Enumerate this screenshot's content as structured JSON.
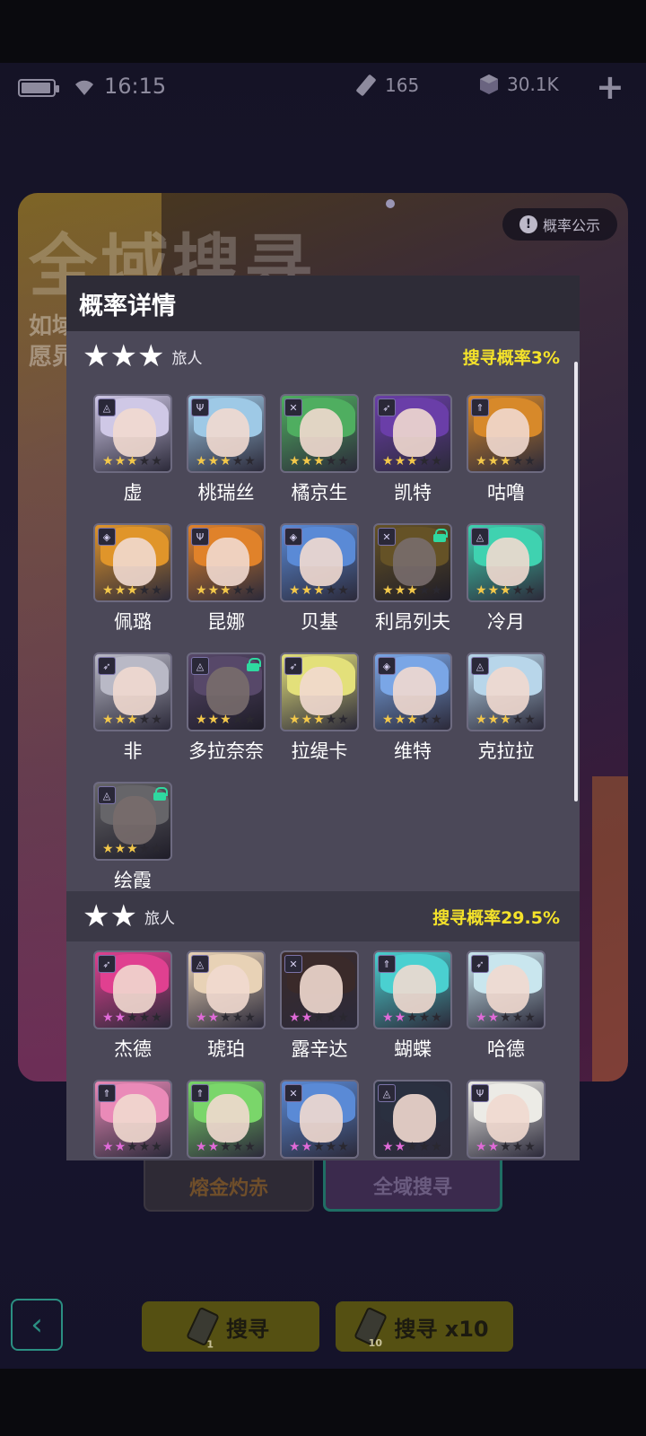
{
  "status_bar": {
    "time": "16:15",
    "ticket_count": "165",
    "crystal_count": "30.1K",
    "add_label": "+"
  },
  "banner": {
    "title": "全域搜寻",
    "line1": "如域",
    "line2": "愿晁",
    "prob_button": "概率公示"
  },
  "tabs": {
    "left": "熔金灼赤",
    "right": "全域搜寻"
  },
  "actions": {
    "search_one": "搜寻",
    "search_ten": "搜寻 x10",
    "ticket_one": "1",
    "ticket_ten": "10"
  },
  "modal": {
    "title": "概率详情",
    "tiers": [
      {
        "stars": "★★★",
        "label": "旅人",
        "rate": "搜寻概率3%",
        "characters": [
          {
            "name": "虚",
            "class_icon": "cursed-icon",
            "locked": false,
            "hair": "#cfc8e6"
          },
          {
            "name": "桃瑞丝",
            "class_icon": "trident-icon",
            "locked": false,
            "hair": "#9ec9e6"
          },
          {
            "name": "橘京生",
            "class_icon": "swords-icon",
            "locked": false,
            "hair": "#4fae60"
          },
          {
            "name": "凯特",
            "class_icon": "bow-icon",
            "locked": false,
            "hair": "#6a3ea8"
          },
          {
            "name": "咕噜",
            "class_icon": "rank-icon",
            "locked": false,
            "hair": "#d7892a"
          },
          {
            "name": "佩璐",
            "class_icon": "diamond-icon",
            "locked": false,
            "hair": "#e0952a"
          },
          {
            "name": "昆娜",
            "class_icon": "trident-icon",
            "locked": false,
            "hair": "#e0822a"
          },
          {
            "name": "贝基",
            "class_icon": "diamond-icon",
            "locked": false,
            "hair": "#5a8ad6"
          },
          {
            "name": "利昂列夫",
            "class_icon": "swords-icon",
            "locked": true,
            "hair": "#c7a035"
          },
          {
            "name": "冷月",
            "class_icon": "cursed-icon",
            "locked": false,
            "hair": "#3fd2b0"
          },
          {
            "name": "非",
            "class_icon": "bow-icon",
            "locked": false,
            "hair": "#b9b9c6"
          },
          {
            "name": "多拉奈奈",
            "class_icon": "cursed-icon",
            "locked": true,
            "hair": "#a98acb"
          },
          {
            "name": "拉缇卡",
            "class_icon": "bow-icon",
            "locked": false,
            "hair": "#e3e07a"
          },
          {
            "name": "维特",
            "class_icon": "diamond-icon",
            "locked": false,
            "hair": "#7aa6e6"
          },
          {
            "name": "克拉拉",
            "class_icon": "cursed-icon",
            "locked": false,
            "hair": "#b8d6ea"
          },
          {
            "name": "绘霞",
            "class_icon": "cursed-icon",
            "locked": true,
            "hair": "#c9c9c9"
          }
        ]
      },
      {
        "stars": "★★",
        "label": "旅人",
        "rate": "搜寻概率29.5%",
        "characters": [
          {
            "name": "杰德",
            "class_icon": "bow-icon",
            "locked": false,
            "hair": "#e04090"
          },
          {
            "name": "琥珀",
            "class_icon": "cursed-icon",
            "locked": false,
            "hair": "#e8d2b6"
          },
          {
            "name": "露辛达",
            "class_icon": "swords-icon",
            "locked": false,
            "hair": "#3a2a2a"
          },
          {
            "name": "蝴蝶",
            "class_icon": "rank-icon",
            "locked": false,
            "hair": "#4ad0d0"
          },
          {
            "name": "哈德",
            "class_icon": "bow-icon",
            "locked": false,
            "hair": "#c9e6ee"
          },
          {
            "name": "",
            "class_icon": "rank-icon",
            "locked": false,
            "hair": "#ea8ab8"
          },
          {
            "name": "",
            "class_icon": "rank-icon",
            "locked": false,
            "hair": "#7ad66a"
          },
          {
            "name": "",
            "class_icon": "swords-icon",
            "locked": false,
            "hair": "#5a8ad6"
          },
          {
            "name": "",
            "class_icon": "cursed-icon",
            "locked": false,
            "hair": "#2a3040"
          },
          {
            "name": "",
            "class_icon": "trident-icon",
            "locked": false,
            "hair": "#ecebe6"
          }
        ]
      }
    ]
  }
}
